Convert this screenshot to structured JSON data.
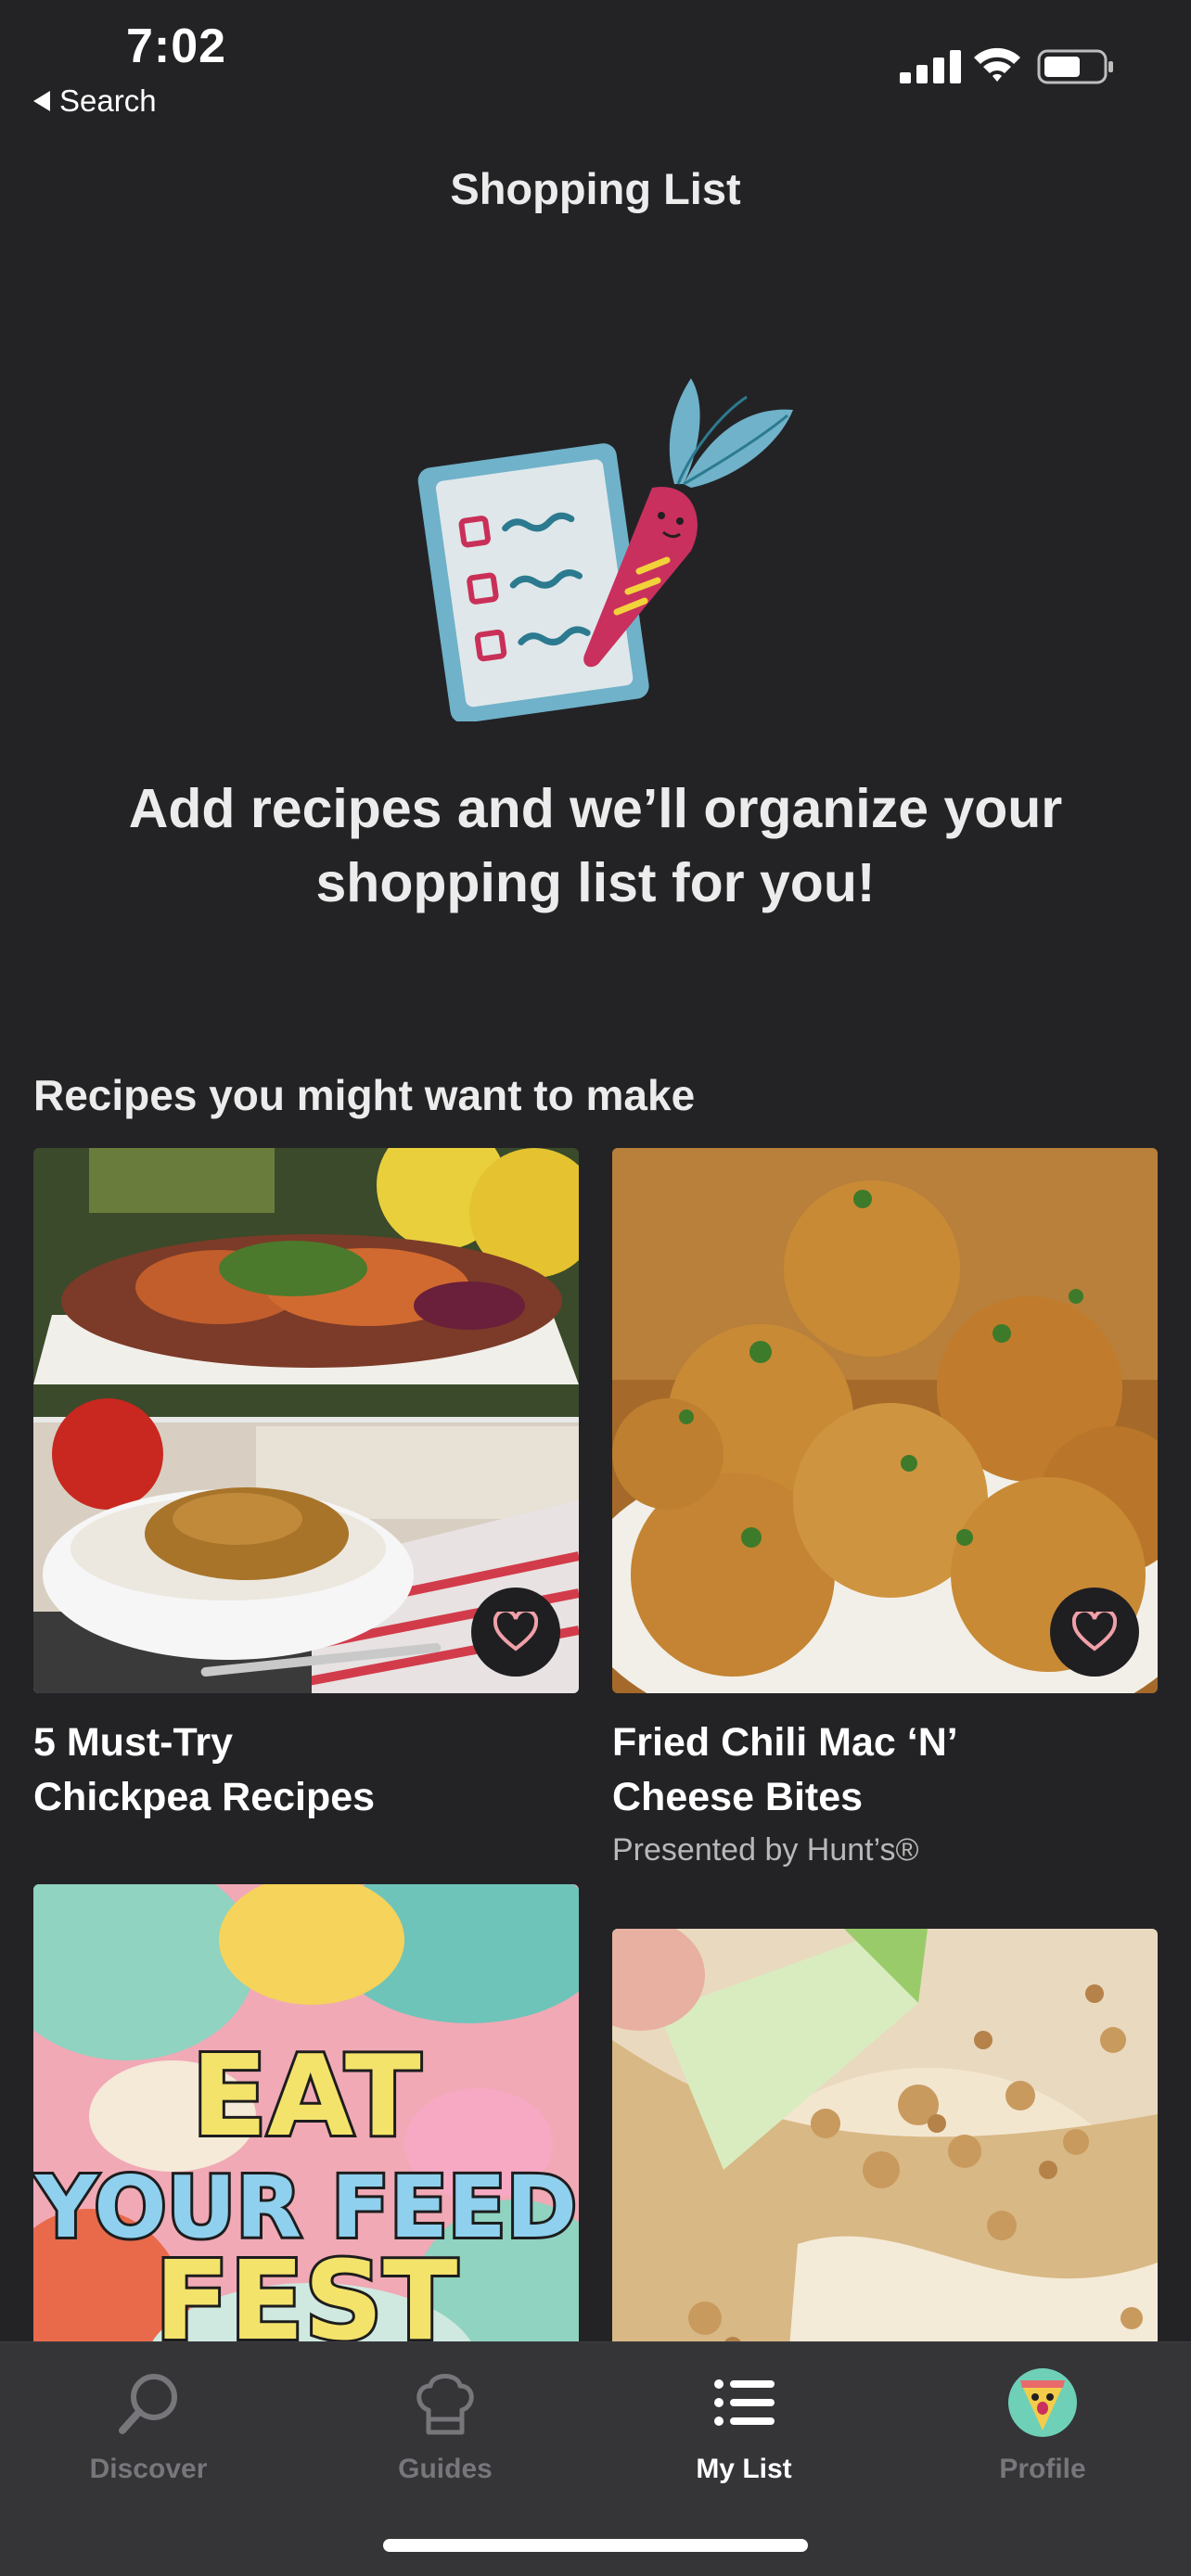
{
  "status_bar": {
    "time": "7:02",
    "back_label": "Search"
  },
  "header": {
    "title": "Shopping List"
  },
  "empty_state": {
    "illustration": "checklist-carrot",
    "message": "Add recipes and we’ll organize your shopping list for you!"
  },
  "recommendations": {
    "section_title": "Recipes you might want to make",
    "cards": [
      {
        "title": "5 Must-Try\nChickpea Recipes",
        "subtitle": "",
        "favorite": false
      },
      {
        "title": "Fried Chili Mac ‘N’\nCheese Bites",
        "subtitle": "Presented by Hunt’s®",
        "favorite": false
      },
      {
        "title": "",
        "subtitle": "",
        "image_text": [
          "EAT",
          "YOUR FEED",
          "FEST"
        ]
      },
      {
        "title": "",
        "subtitle": ""
      }
    ]
  },
  "tab_bar": {
    "tabs": [
      {
        "label": "Discover",
        "icon": "search-icon",
        "active": false
      },
      {
        "label": "Guides",
        "icon": "chef-hat-icon",
        "active": false
      },
      {
        "label": "My List",
        "icon": "list-icon",
        "active": true
      },
      {
        "label": "Profile",
        "icon": "avatar-icon",
        "active": false
      }
    ]
  },
  "colors": {
    "background": "#232326",
    "tabbar": "#353538",
    "heart": "#f0a0a8",
    "text": "#ececec"
  }
}
